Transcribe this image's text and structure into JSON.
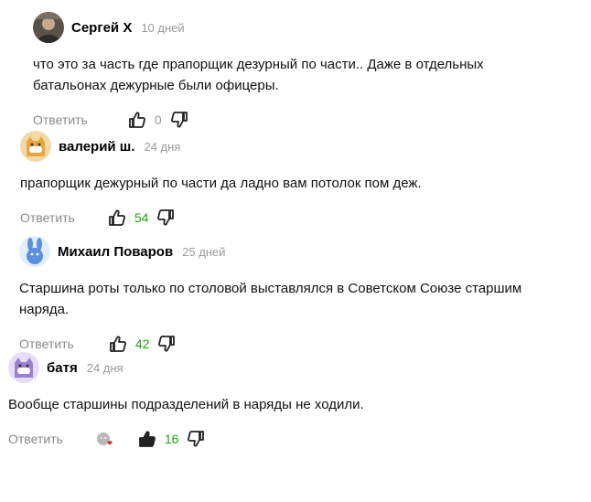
{
  "comments": [
    {
      "author": "Сергей X",
      "date": "10 дней",
      "text": "что это за часть где прапорщик дезурный по части.. Даже в отдельных батальонах дежурные были офицеры.",
      "reply_label": "Ответить",
      "likes": "0",
      "avatar": "photo-avatar"
    },
    {
      "author": "валерий ш.",
      "date": "24 дня",
      "text": "прапорщик дежурный по части да ладно вам потолок пом деж.",
      "reply_label": "Ответить",
      "likes": "54",
      "avatar": "cat-avatar-orange"
    },
    {
      "author": "Михаил Поваров",
      "date": "25 дней",
      "text": "Старшина роты только по столовой выставлялся в Советском Союзе старшим наряда.",
      "reply_label": "Ответить",
      "likes": "42",
      "avatar": "bunny-avatar-blue"
    },
    {
      "author": "батя",
      "date": "24 дня",
      "text": "Вообще старшины подразделений в наряды не ходили.",
      "reply_label": "Ответить",
      "likes": "16",
      "avatar": "cat-avatar-purple"
    }
  ],
  "colors": {
    "positive_count": "#1fa30f",
    "muted_text": "#8a8a8a",
    "date_text": "#999999"
  }
}
